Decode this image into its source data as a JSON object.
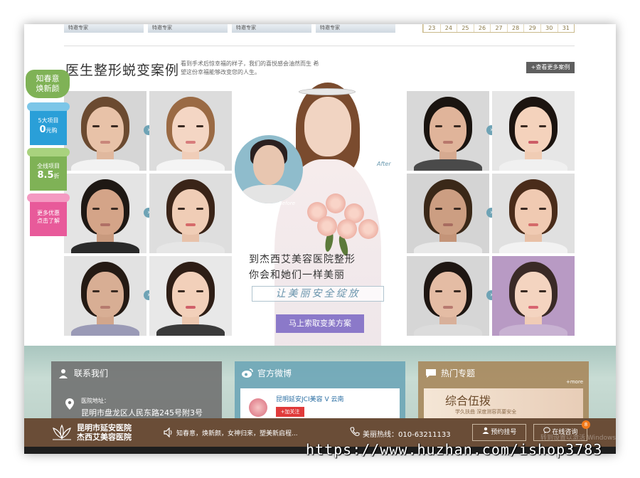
{
  "top_strip": {
    "doc_label": "特邀专家",
    "calendar_days": [
      "23",
      "24",
      "25",
      "26",
      "27",
      "28",
      "29",
      "30",
      "31"
    ]
  },
  "section": {
    "title": "医生整形蜕变案例",
    "description": "看到手术后惊幸福的样子，我们的喜悦感会油然而生  希望这份幸福能够改变您的人生。",
    "more_button": "+查看更多案例"
  },
  "float_nav": {
    "cloud_text_1": "知春意",
    "cloud_text_2": "焕新颜",
    "box1_line1": "5大项目",
    "box1_num": "0",
    "box1_unit": "元购",
    "box2_line1": "全线项目",
    "box2_num": "8.5",
    "box2_unit": "折",
    "box3_line1": "更多优惠",
    "box3_line2": "点击了解",
    "colors": {
      "green": "#7fb256",
      "blue": "#2a9fd8",
      "pink": "#e85a9a"
    }
  },
  "hero": {
    "before_label": "Before",
    "after_label": "After",
    "line1": "到杰西艾美容医院整形",
    "line2": "你会和她们一样美丽",
    "slogan": "让美丽安全绽放",
    "cta": "马上索取变美方案"
  },
  "arrow_glyph": "›",
  "panels": {
    "contact": {
      "title": "联系我们",
      "label": "医院地址：",
      "address": "昆明市盘龙区人民东路245号附3号",
      "color": "#7d7d7d"
    },
    "weibo": {
      "title": "官方微博",
      "name": "昆明延安JCI美容 V  云南",
      "follow": "+加关注",
      "color": "#6fa7b7"
    },
    "topic": {
      "title": "热门专题",
      "more": "+more",
      "banner_title": "综合伍拨",
      "banner_sub": "学久扶曲  深度测容高要安全",
      "color": "#a88a5e"
    }
  },
  "bottom_bar": {
    "hospital_line1": "昆明市延安医院",
    "hospital_line2": "杰西艾美容医院",
    "slogan": "知春意，焕新颜，女神归来，塑美新启程...",
    "hotline": "美丽热线：010-63211133",
    "book_button": "预约挂号",
    "consult_button": "在线咨询",
    "consult_badge": "8"
  },
  "faint_text": "转到设置以激活 Windows",
  "watermark": "https://www.huzhan.com/ishop3783"
}
